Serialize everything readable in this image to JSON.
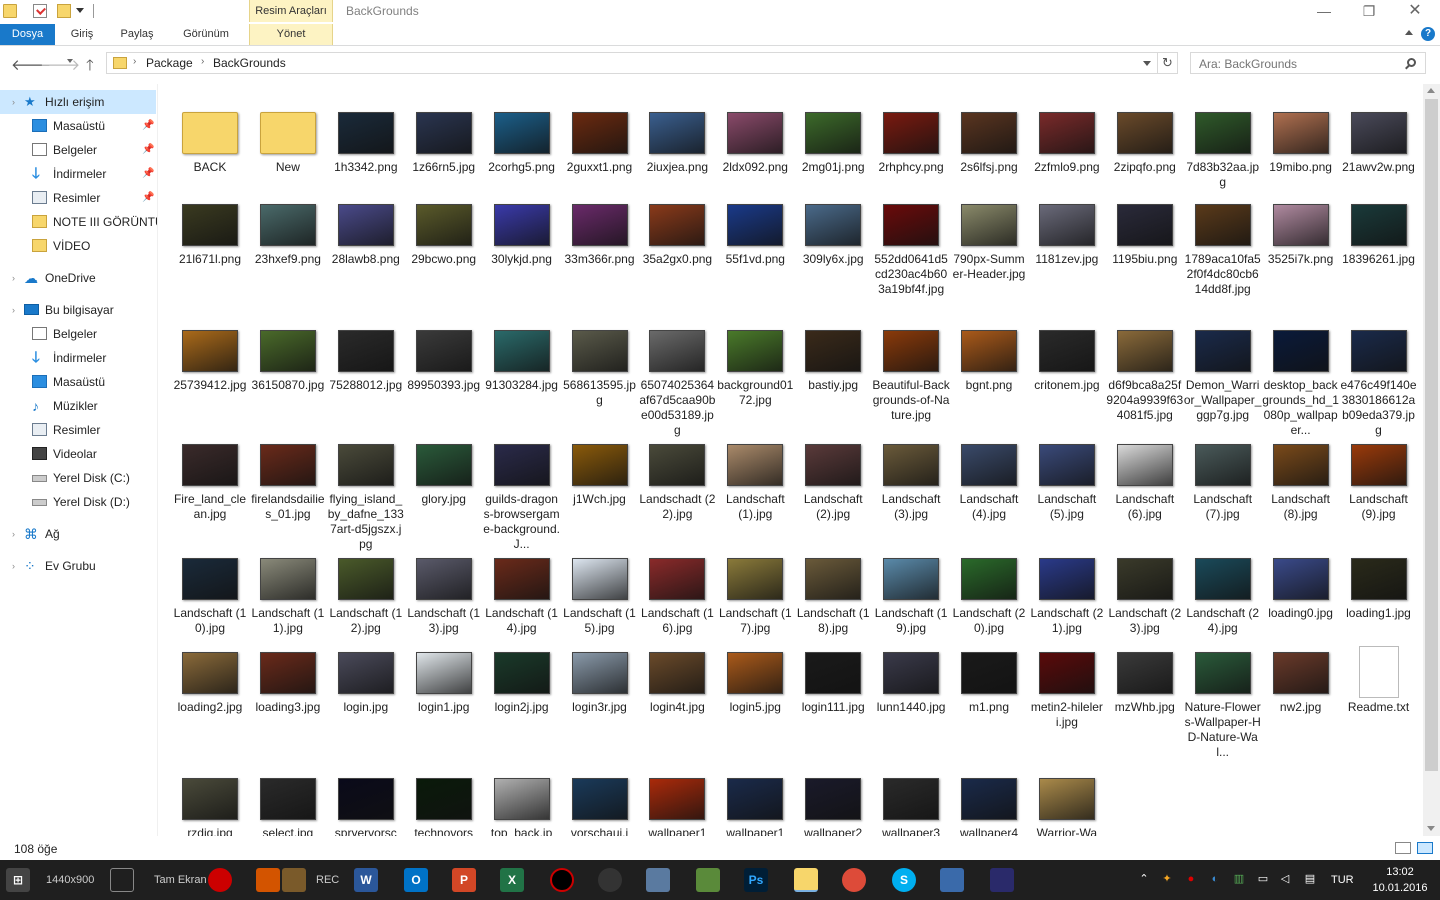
{
  "window": {
    "title": "BackGrounds",
    "contextual_tab_header": "Resim Araçları",
    "minimize": "—",
    "maximize": "❐",
    "close": "✕"
  },
  "ribbon": {
    "tabs": [
      "Dosya",
      "Giriş",
      "Paylaş",
      "Görünüm",
      "Yönet"
    ]
  },
  "address": {
    "crumbs": [
      "Package",
      "BackGrounds"
    ],
    "search_placeholder": "Ara: BackGrounds"
  },
  "nav": {
    "items": [
      {
        "label": "Hızlı erişim",
        "icon": "quick-access-icon",
        "selected": true
      },
      {
        "label": "Masaüstü",
        "icon": "desktop-icon",
        "pinned": true
      },
      {
        "label": "Belgeler",
        "icon": "documents-icon",
        "pinned": true
      },
      {
        "label": "İndirmeler",
        "icon": "downloads-icon",
        "pinned": true
      },
      {
        "label": "Resimler",
        "icon": "pictures-icon",
        "pinned": true
      },
      {
        "label": "NOTE III GÖRÜNTÜ",
        "icon": "folder-icon"
      },
      {
        "label": "VİDEO",
        "icon": "folder-icon"
      },
      {
        "label": "OneDrive",
        "icon": "onedrive-icon"
      },
      {
        "label": "Bu bilgisayar",
        "icon": "this-pc-icon"
      },
      {
        "label": "Belgeler",
        "icon": "documents-icon"
      },
      {
        "label": "İndirmeler",
        "icon": "downloads-icon"
      },
      {
        "label": "Masaüstü",
        "icon": "desktop-icon"
      },
      {
        "label": "Müzikler",
        "icon": "music-icon"
      },
      {
        "label": "Resimler",
        "icon": "pictures-icon"
      },
      {
        "label": "Videolar",
        "icon": "videos-icon"
      },
      {
        "label": "Yerel Disk (C:)",
        "icon": "local-disk-icon"
      },
      {
        "label": "Yerel Disk (D:)",
        "icon": "local-disk-icon"
      },
      {
        "label": "Ağ",
        "icon": "network-icon"
      },
      {
        "label": "Ev Grubu",
        "icon": "homegroup-icon"
      }
    ]
  },
  "files": [
    [
      "BACK",
      "New",
      "1h3342.png",
      "1z66rn5.jpg",
      "2corhg5.png",
      "2guxxt1.png",
      "2iuxjea.png",
      "2ldx092.png",
      "2mg01j.png",
      "2rhphcy.png",
      "2s6lfsj.png",
      "2zfmlo9.png",
      "2zipqfo.png",
      "7d83b32aa.jpg",
      "19mibo.png",
      "21awv2w.png"
    ],
    [
      "21l671l.png",
      "23hxef9.png",
      "28lawb8.png",
      "29bcwo.png",
      "30lykjd.png",
      "33m366r.png",
      "35a2gx0.png",
      "55f1vd.png",
      "309ly6x.jpg",
      "552dd0641d5cd230ac4b603a19bf4f.jpg",
      "790px-Summer-Header.jpg",
      "1181zev.jpg",
      "1195biu.png",
      "1789aca10fa52f0f4dc80cb614dd8f.jpg",
      "3525i7k.png",
      "18396261.jpg"
    ],
    [
      "25739412.jpg",
      "36150870.jpg",
      "75288012.jpg",
      "89950393.jpg",
      "91303284.jpg",
      "568613595.jpg",
      "65074025364af67d5caa90be00d53189.jpg",
      "background0172.jpg",
      "bastiy.jpg",
      "Beautiful-Backgrounds-of-Nature.jpg",
      "bgnt.png",
      "critonem.jpg",
      "d6f9bca8a25f9204a9939f634081f5.jpg",
      "Demon_Warrior_Wallpaper_ggp7g.jpg",
      "desktop_backgrounds_hd_1080p_wallpaper...",
      "e476c49f140e3830186612ab09eda379.jpg"
    ],
    [
      "Fire_land_clean.jpg",
      "firelandsdailies_01.jpg",
      "flying_island_by_dafne_1337art-d5jgszx.jpg",
      "glory.jpg",
      "guilds-dragons-browsergame-background.J...",
      "j1Wch.jpg",
      "Landschadt (22).jpg",
      "Landschaft (1).jpg",
      "Landschaft (2).jpg",
      "Landschaft (3).jpg",
      "Landschaft (4).jpg",
      "Landschaft (5).jpg",
      "Landschaft (6).jpg",
      "Landschaft (7).jpg",
      "Landschaft (8).jpg",
      "Landschaft (9).jpg"
    ],
    [
      "Landschaft (10).jpg",
      "Landschaft (11).jpg",
      "Landschaft (12).jpg",
      "Landschaft (13).jpg",
      "Landschaft (14).jpg",
      "Landschaft (15).jpg",
      "Landschaft (16).jpg",
      "Landschaft (17).jpg",
      "Landschaft (18).jpg",
      "Landschaft (19).jpg",
      "Landschaft (20).jpg",
      "Landschaft (21).jpg",
      "Landschaft (23).jpg",
      "Landschaft (24).jpg",
      "loading0.jpg",
      "loading1.jpg"
    ],
    [
      "loading2.jpg",
      "loading3.jpg",
      "login.jpg",
      "login1.jpg",
      "login2j.jpg",
      "login3r.jpg",
      "login4t.jpg",
      "login5.jpg",
      "login111.jpg",
      "lunn1440.jpg",
      "m1.png",
      "metin2-hileleri.jpg",
      "mzWhb.jpg",
      "Nature-Flowers-Wallpaper-HD-Nature-Wal...",
      "nw2.jpg",
      "Readme.txt"
    ],
    [
      "rzdjg.jpg",
      "select.jpg",
      "spryervorsc",
      "technovors",
      "top_back.jp",
      "vorschaui.j",
      "wallpaper1",
      "wallpaper1",
      "wallpaper2",
      "wallpaper3",
      "wallpaper4",
      "Warrior-Wa"
    ]
  ],
  "thumb_colors": [
    [
      "#c9a33d",
      "#f7d66b",
      "#1a2a3a",
      "#2a3550",
      "#1b5f8a",
      "#6b2a10",
      "#3a5f8f",
      "#8a4a6a",
      "#3c6a2a",
      "#7a1a10",
      "#5a3520",
      "#7a2a2a",
      "#6a4a2a",
      "#2f5a2a",
      "#b07050",
      "#4a4a5a"
    ],
    [
      "#3a3a20",
      "#4a6a6a",
      "#4a4a8a",
      "#5a5a2a",
      "#3a3aaa",
      "#6a2a6a",
      "#8a3a1a",
      "#1a3a8a",
      "#4a6a8a",
      "#6a0a0a",
      "#8a8a6a",
      "#6a6a7a",
      "#2a2a3a",
      "#5a3a1a",
      "#b08aa0",
      "#1a3a3a"
    ],
    [
      "#aa6a1a",
      "#4a6a2a",
      "#2a2a2a",
      "#3a3a3a",
      "#2a6a6a",
      "#5a5a4a",
      "#6a6a6a",
      "#4a7a2a",
      "#3a2a1a",
      "#8a3a0a",
      "#aa5a1a",
      "#2a2a2a",
      "#8a6a3a",
      "#1a2a4a",
      "#0a1a3a",
      "#1a2a4a"
    ],
    [
      "#3a2a2a",
      "#6a2a1a",
      "#4a4a3a",
      "#2a5a3a",
      "#2a2a4a",
      "#8a5a0a",
      "#4a4a3a",
      "#aa8a6a",
      "#5a3a3a",
      "#6a5a3a",
      "#3a4a6a",
      "#3a4a7a",
      "#dadada",
      "#4a5a5a",
      "#7a4a1a",
      "#9a3a0a"
    ],
    [
      "#1a2a3a",
      "#8a8a7a",
      "#4a5a2a",
      "#5a5a6a",
      "#6a2a1a",
      "#dde6f0",
      "#8a2a2a",
      "#8a7a3a",
      "#6a5a3a",
      "#5a8aaa",
      "#2a6a2a",
      "#2a3a8a",
      "#3a3a2a",
      "#1a4a5a",
      "#3a4a8a",
      "#2a2a1a"
    ],
    [
      "#8a6a3a",
      "#6a2a1a",
      "#4a4a5a",
      "#e0e6ea",
      "#1a3a2a",
      "#8a9aaa",
      "#6a4a2a",
      "#aa5a1a",
      "#1a1a1a",
      "#3a3a4a",
      "#1a1a1a",
      "#5a0a0a",
      "#3a3a3a",
      "#2a5a3a",
      "#6a3a2a",
      "#ffffff"
    ],
    [
      "#4a4a3a",
      "#2a2a2a",
      "#0a0a1a",
      "#0a1a0a",
      "#b0b0b0",
      "#1a3a5a",
      "#aa2a0a",
      "#1a2a4a",
      "#1a1a2a",
      "#2a2a2a",
      "#1a2a4a",
      "#aa8a4a"
    ]
  ],
  "status": {
    "item_count": "108 öğe"
  },
  "taskbar": {
    "screen_size": "1440x900",
    "tam_ekran": "Tam Ekran",
    "rec": "REC",
    "language": "TUR",
    "time": "13:02",
    "date": "10.01.2016"
  }
}
